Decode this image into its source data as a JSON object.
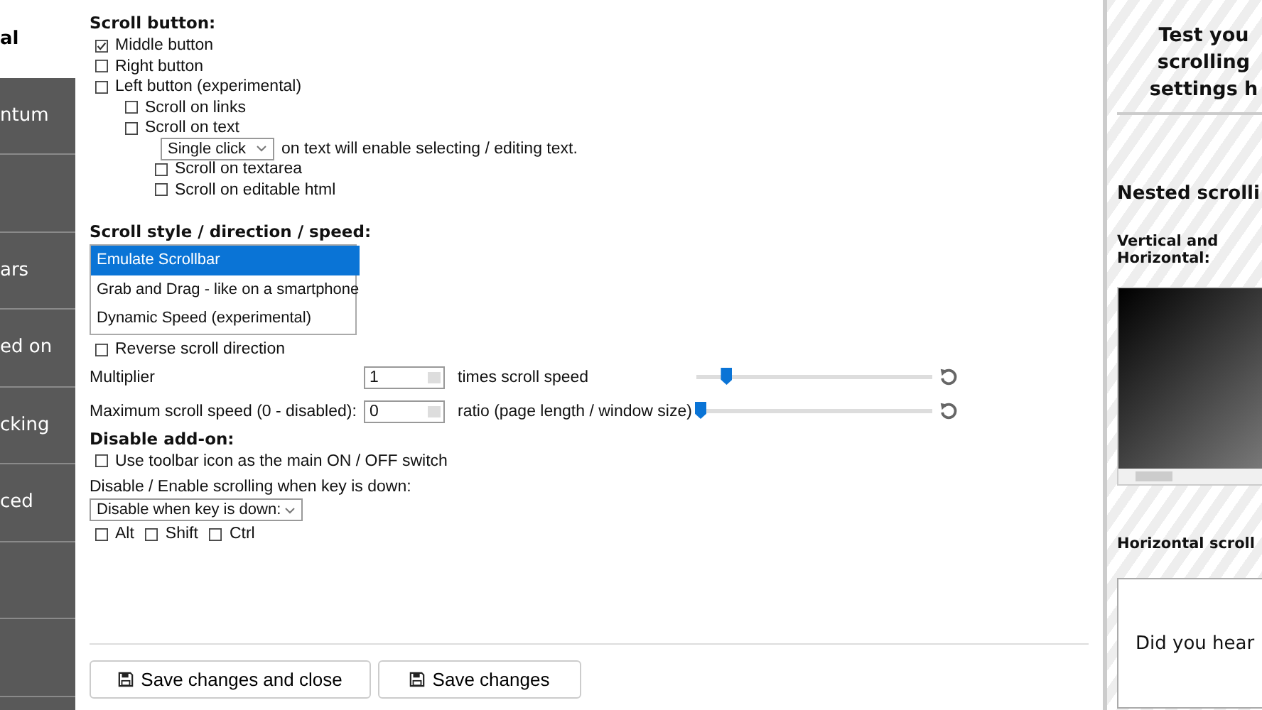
{
  "sidebar": {
    "items": [
      {
        "label": "al",
        "selected": true
      },
      {
        "label": "ntum",
        "selected": false
      },
      {
        "selected": false
      },
      {
        "label": "ars",
        "selected": false
      },
      {
        "label": "ed on",
        "selected": false
      },
      {
        "label": "cking",
        "selected": false
      },
      {
        "label": "ced",
        "selected": false
      },
      {
        "selected": false
      },
      {
        "selected": false
      }
    ]
  },
  "scroll_button": {
    "heading": "Scroll button:",
    "options": [
      {
        "kind": "checkbox",
        "label": "Middle button",
        "checked": true
      },
      {
        "kind": "checkbox",
        "label": "Right button",
        "checked": false
      },
      {
        "kind": "checkbox",
        "label": "Left button (experimental)",
        "checked": false,
        "children": [
          {
            "kind": "checkbox",
            "label": "Scroll on links",
            "checked": false
          },
          {
            "kind": "checkbox",
            "label": "Scroll on text",
            "checked": false,
            "children": [
              {
                "kind": "select",
                "value": "Single click",
                "text": "on text will enable selecting / editing text."
              },
              {
                "kind": "checkbox",
                "label": "Scroll on textarea",
                "checked": false
              },
              {
                "kind": "checkbox",
                "label": "Scroll on editable html",
                "checked": false
              }
            ]
          }
        ]
      }
    ]
  },
  "scroll_style": {
    "heading": "Scroll style / direction / speed:",
    "listbox": [
      {
        "label": "Emulate Scrollbar",
        "selected": true
      },
      {
        "label": "Grab and Drag - like on a smartphone",
        "selected": false
      },
      {
        "label": "Dynamic Speed (experimental)",
        "selected": false
      }
    ],
    "reverse": {
      "label": "Reverse scroll direction",
      "checked": false
    },
    "settings": [
      {
        "label": "Multiplier",
        "value": "1",
        "suffix": "times scroll speed",
        "level": 0.11
      },
      {
        "label": "Maximum scroll speed (0 - disabled):",
        "value": "0",
        "suffix": "ratio (page length / window size)",
        "level": 0
      }
    ]
  },
  "disable": {
    "heading": "Disable add-on:",
    "toolbar_switch": {
      "label": "Use toolbar icon as the main ON / OFF switch",
      "checked": false
    },
    "key_label": "Disable / Enable scrolling when key is down:",
    "key_mode": "Disable when key is down:",
    "keys": [
      {
        "label": "Alt",
        "checked": false
      },
      {
        "label": "Shift",
        "checked": false
      },
      {
        "label": "Ctrl",
        "checked": false
      }
    ]
  },
  "buttons": [
    "Save changes and close",
    "Save changes"
  ],
  "test_panel": {
    "title_lines": [
      "Test you",
      "scrolling",
      "settings h"
    ],
    "nested_heading": "Nested scrolli",
    "vh_label": "Vertical and Horizontal:",
    "horizontal_label": "Horizontal scroll",
    "sample_text": "Did you hear"
  }
}
